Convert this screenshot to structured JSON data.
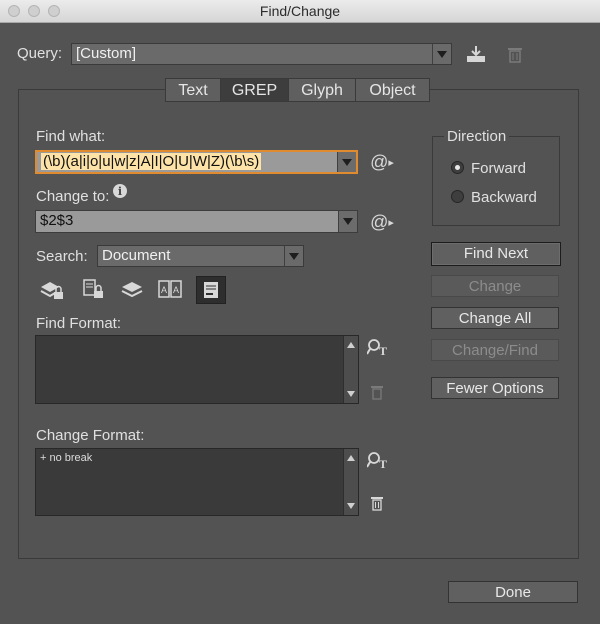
{
  "window": {
    "title": "Find/Change"
  },
  "query": {
    "label": "Query:",
    "value": "[Custom]"
  },
  "tabs": [
    {
      "label": "Text"
    },
    {
      "label": "GREP"
    },
    {
      "label": "Glyph"
    },
    {
      "label": "Object"
    }
  ],
  "find_what": {
    "label": "Find what:",
    "value": "(\\b)(a|i|o|u|w|z|A|I|O|U|W|Z)(\\b\\s)"
  },
  "change_to": {
    "label": "Change to:",
    "value": "$2$3"
  },
  "search": {
    "label": "Search:",
    "value": "Document"
  },
  "find_format": {
    "label": "Find Format:",
    "value": ""
  },
  "change_format": {
    "label": "Change Format:",
    "value": "+ no break"
  },
  "direction": {
    "label": "Direction",
    "options": [
      {
        "label": "Forward",
        "checked": true
      },
      {
        "label": "Backward",
        "checked": false
      }
    ]
  },
  "buttons": {
    "find_next": "Find Next",
    "change": "Change",
    "change_all": "Change All",
    "change_find": "Change/Find",
    "fewer_options": "Fewer Options",
    "done": "Done"
  },
  "colors": {
    "find_field_bg": "#fde3a7",
    "find_field_border": "#e08b2f"
  }
}
